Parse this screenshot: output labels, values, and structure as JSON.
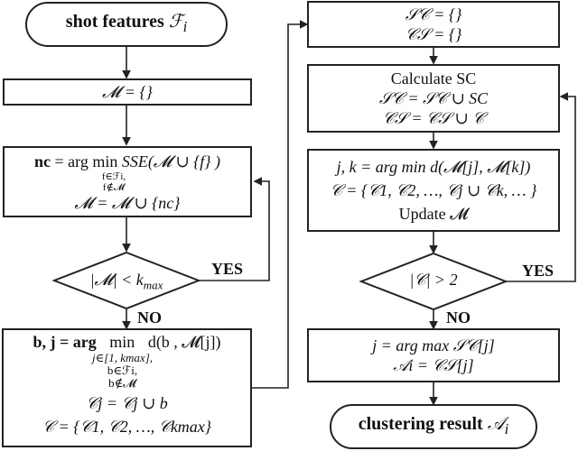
{
  "left_column": {
    "start": {
      "text": "shot features ",
      "symbol": "ℱ",
      "subscript": "i"
    },
    "init_m": "𝓜 = {}",
    "select_nc": {
      "line1_prefix": "nc",
      "line1_mid": " = arg min",
      "line1_expr": "SSE(𝓜 ∪ {f} )",
      "under1": "f∈ℱi,",
      "under2": "f∉𝓜",
      "line2": "𝓜 = 𝓜 ∪ {nc}"
    },
    "decision": {
      "text": "|𝓜| < k",
      "subscript": "max"
    },
    "decision_yes": "YES",
    "decision_no": "NO",
    "assign": {
      "line1_a": "b, j = arg",
      "line1_min": "min",
      "line1_b": "d(b , 𝓜[j])",
      "under1": "j∈[1, kmax],",
      "under2": "b∈ℱi,",
      "under3": "b∉𝓜",
      "line2": "𝒞j = 𝒞j ∪ b",
      "line3": "𝒞 = {𝒞1, 𝒞2, …, 𝒞kmax}"
    }
  },
  "right_column": {
    "init_sets": {
      "line1": "𝒮𝒞 = {}",
      "line2": "𝒞𝒮 = {}"
    },
    "calc": {
      "line1": "Calculate SC",
      "line2": "𝒮𝒞 = 𝒮𝒞 ∪ SC",
      "line3": "𝒞𝒮 = 𝒞𝒮 ∪ 𝒞"
    },
    "merge": {
      "line1": "j, k = arg min d(𝓜[j], 𝓜[k])",
      "line2": "𝒞 = {𝒞1, 𝒞2, …, 𝒞j ∪ 𝒞k, … }",
      "line3": "Update 𝓜"
    },
    "decision": {
      "text": "|𝒞| > 2"
    },
    "decision_yes": "YES",
    "decision_no": "NO",
    "select": {
      "line1": "j = arg max 𝒮𝒞[j]",
      "line2": "𝒜i = 𝒞𝒮[j]"
    },
    "end": {
      "text": "clustering result ",
      "symbol": "𝒜",
      "subscript": "i"
    }
  }
}
